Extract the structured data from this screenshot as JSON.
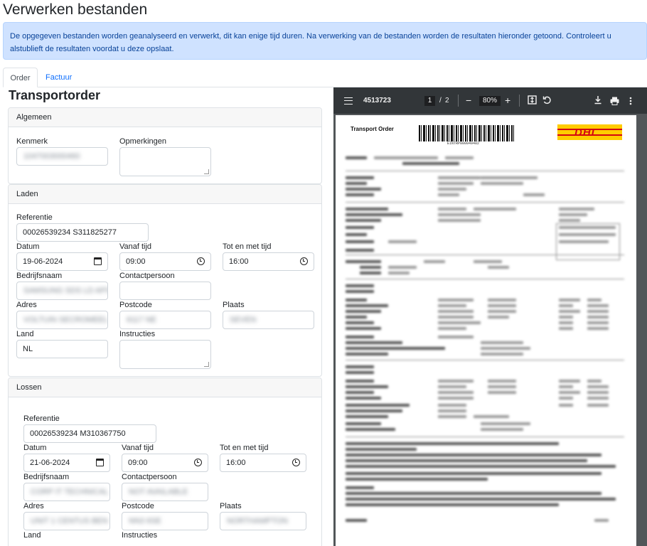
{
  "page": {
    "title": "Verwerken bestanden"
  },
  "alert": {
    "text": "De opgegeven bestanden worden geanalyseerd en verwerkt, dit kan enige tijd duren. Na verwerking van de bestanden worden de resultaten hieronder getoond. Controleert u alstublieft de resultaten voordat u deze opslaat."
  },
  "tabs": [
    {
      "label": "Order",
      "active": true
    },
    {
      "label": "Factuur",
      "active": false
    }
  ],
  "form": {
    "title": "Transportorder",
    "algemeen": {
      "header": "Algemeen",
      "kenmerk_label": "Kenmerk",
      "opmerkingen_label": "Opmerkingen"
    },
    "laden": {
      "header": "Laden",
      "referentie_label": "Referentie",
      "referentie_value": "00026539234 S311825277",
      "datum_label": "Datum",
      "datum_value": "19-06-2024",
      "vanaf_label": "Vanaf tijd",
      "vanaf_value": "09:00",
      "tot_label": "Tot en met tijd",
      "tot_value": "16:00",
      "bedrijfsnaam_label": "Bedrijfsnaam",
      "contactpersoon_label": "Contactpersoon",
      "adres_label": "Adres",
      "postcode_label": "Postcode",
      "plaats_label": "Plaats",
      "land_label": "Land",
      "land_value": "NL",
      "instructies_label": "Instructies"
    },
    "lossen": {
      "header": "Lossen",
      "referentie_label": "Referentie",
      "referentie_value": "00026539234 M310367750",
      "datum_label": "Datum",
      "datum_value": "21-06-2024",
      "vanaf_label": "Vanaf tijd",
      "vanaf_value": "09:00",
      "tot_label": "Tot en met tijd",
      "tot_value": "16:00",
      "bedrijfsnaam_label": "Bedrijfsnaam",
      "contactpersoon_label": "Contactpersoon",
      "adres_label": "Adres",
      "postcode_label": "Postcode",
      "plaats_label": "Plaats",
      "land_label": "Land",
      "instructies_label": "Instructies"
    }
  },
  "pdf_viewer": {
    "title": "4513723",
    "current_page": "1",
    "separator": "/",
    "total_pages": "2",
    "zoom": "80%",
    "doc_title": "Transport Order",
    "barcode_text": "EINTRP000049482",
    "logo_text": "DHL"
  },
  "icons": {
    "menu": "menu-icon",
    "zoom_out": "minus-icon",
    "zoom_in": "plus-icon",
    "fit": "fit-page-icon",
    "rotate": "rotate-icon",
    "download": "download-icon",
    "print": "print-icon",
    "more": "more-vertical-icon",
    "calendar": "calendar-icon",
    "clock": "clock-icon"
  },
  "colors": {
    "alert_bg": "#cfe2ff",
    "alert_text": "#084298",
    "link": "#0d6efd",
    "pdf_toolbar": "#323639",
    "dhl_yellow": "#ffcc00",
    "dhl_red": "#d40511"
  }
}
